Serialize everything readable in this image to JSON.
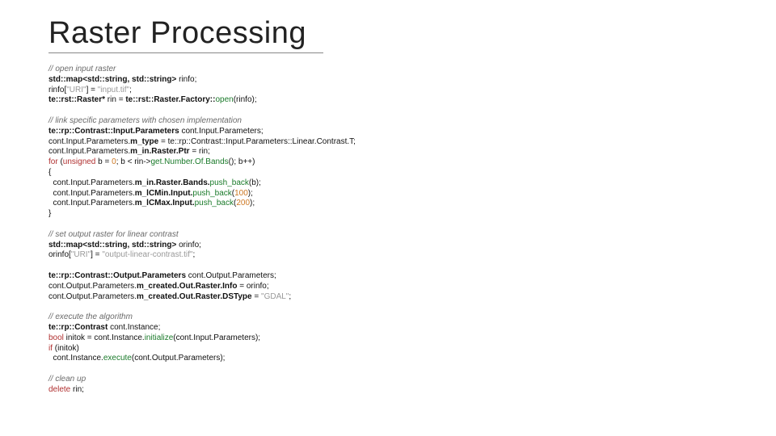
{
  "slide": {
    "title": "Raster Processing",
    "code": {
      "c1": "// open input raster",
      "l2a": "std::map<std::string, std::string>",
      "l2b": "rinfo;",
      "l3a": "rinfo[",
      "l3b": "\"URI\"",
      "l3c": "] = ",
      "l3d": "\"input.tif\"",
      "l3e": ";",
      "l4a": "te::rst::Raster*",
      "l4b": "rin",
      "l4c": " = ",
      "l4d": "te::rst::Raster.Factory::",
      "l4e": "open",
      "l4f": "(rinfo);",
      "c2": "// link specific parameters with chosen implementation",
      "l6a": "te::rp::Contrast::Input.Parameters",
      "l6b": "cont.Input.Parameters;",
      "l7a": "cont.Input.Parameters.",
      "l7b": "m_type",
      "l7c": " = ",
      "l7d": "te::rp::Contrast::Input.Parameters::Linear.Contrast.T;",
      "l8a": "cont.Input.Parameters.",
      "l8b": "m_in.Raster.Ptr",
      "l8c": " = rin;",
      "l9a": "for",
      "l9b": " (",
      "l9c": "unsigned",
      "l9d": " b = ",
      "l9e": "0",
      "l9f": "; b < rin->",
      "l9g": "get.Number.Of.Bands",
      "l9h": "(); b++)",
      "l10": "{",
      "l11a": "  cont.Input.Parameters.",
      "l11b": "m_in.Raster.Bands.",
      "l11c": "push_back",
      "l11d": "(b);",
      "l12a": "  cont.Input.Parameters.",
      "l12b": "m_lCMin.Input.",
      "l12c": "push_back",
      "l12d": "(",
      "l12e": "100",
      "l12f": ");",
      "l13a": "  cont.Input.Parameters.",
      "l13b": "m_lCMax.Input.",
      "l13c": "push_back",
      "l13d": "(",
      "l13e": "200",
      "l13f": ");",
      "l14": "}",
      "c3": "// set output raster for linear contrast",
      "l16a": "std::map<std::string, std::string>",
      "l16b": "orinfo;",
      "l17a": "orinfo[",
      "l17b": "\"URI\"",
      "l17c": "] = ",
      "l17d": "\"output-linear-contrast.tif\"",
      "l17e": ";",
      "l19a": "te::rp::Contrast::Output.Parameters",
      "l19b": "cont.Output.Parameters;",
      "l20a": "cont.Output.Parameters.",
      "l20b": "m_created.Out.Raster.Info",
      "l20c": " = orinfo;",
      "l21a": "cont.Output.Parameters.",
      "l21b": "m_created.Out.Raster.DSType",
      "l21c": " = ",
      "l21d": "\"GDAL\"",
      "l21e": ";",
      "c4": "// execute the algorithm",
      "l23a": "te::rp::Contrast",
      "l23b": "cont.Instance;",
      "l24a": "bool",
      "l24b": " initok = cont.Instance.",
      "l24c": "initialize",
      "l24d": "(cont.Input.Parameters);",
      "l25a": "if",
      "l25b": " (initok)",
      "l26a": "  cont.Instance.",
      "l26b": "execute",
      "l26c": "(cont.Output.Parameters);",
      "c5": "// clean up",
      "l28a": "delete",
      "l28b": " rin;"
    }
  }
}
